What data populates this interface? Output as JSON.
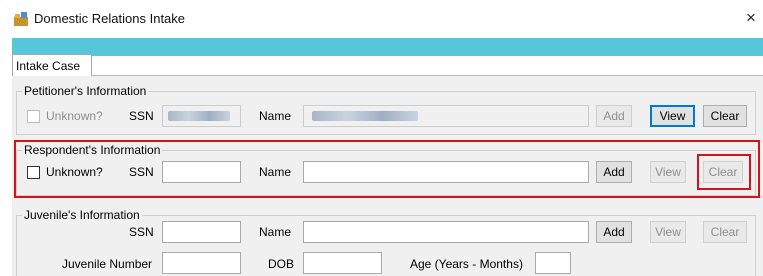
{
  "window": {
    "title": "Domestic Relations Intake",
    "close_glyph": "×"
  },
  "tabs": [
    {
      "label": "Intake Case"
    }
  ],
  "petitioner": {
    "legend": "Petitioner's Information",
    "unknown_label": "Unknown?",
    "ssn_label": "SSN",
    "name_label": "Name",
    "buttons": {
      "add": "Add",
      "view": "View",
      "clear": "Clear"
    }
  },
  "respondent": {
    "legend": "Respondent's Information",
    "unknown_label": "Unknown?",
    "ssn_label": "SSN",
    "name_label": "Name",
    "buttons": {
      "add": "Add",
      "view": "View",
      "clear": "Clear"
    }
  },
  "juvenile": {
    "legend": "Juvenile's Information",
    "ssn_label": "SSN",
    "name_label": "Name",
    "number_label": "Juvenile Number",
    "dob_label": "DOB",
    "age_label": "Age (Years - Months)",
    "buttons": {
      "add": "Add",
      "view": "View",
      "clear": "Clear"
    }
  },
  "colors": {
    "banner": "#55c7d8",
    "highlight": "#d3121a",
    "focus": "#0078d7"
  }
}
